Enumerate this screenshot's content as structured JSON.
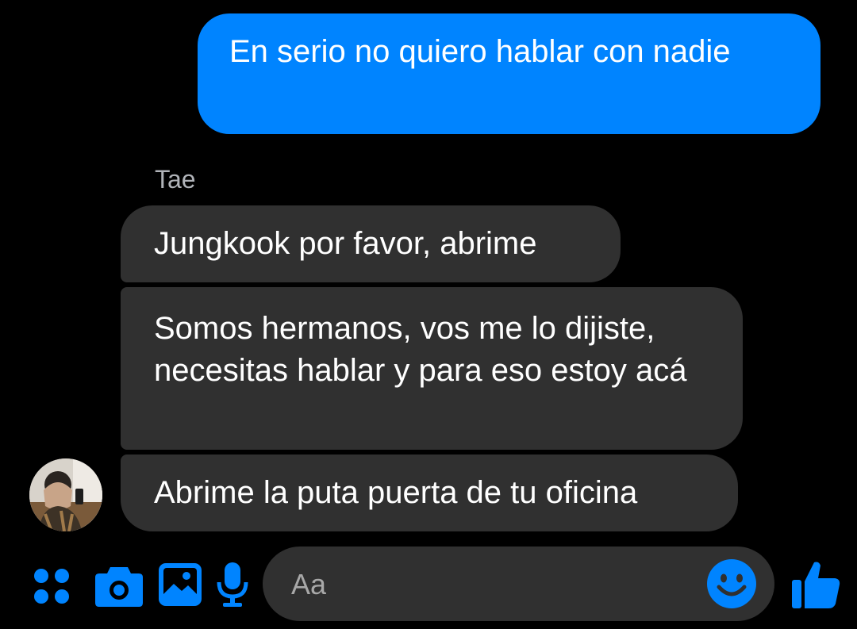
{
  "colors": {
    "accent": "#0084ff",
    "received_bubble": "#303030",
    "background": "#000000"
  },
  "messages": {
    "sent": [
      {
        "text": "En serio no quiero hablar con nadie"
      }
    ],
    "sender_name": "Tae",
    "received": [
      {
        "text": "Jungkook por favor, abrime"
      },
      {
        "text": "Somos hermanos, vos me lo dijiste, necesitas hablar y para eso estoy acá"
      },
      {
        "text": "Abrime la puta puerta de tu oficina"
      }
    ]
  },
  "avatar": {
    "alt": "Tae"
  },
  "toolbar": {
    "icons": [
      "apps-icon",
      "camera-icon",
      "gallery-icon",
      "microphone-icon"
    ],
    "composer_placeholder": "Aa",
    "emoji_icon": "smiley-icon",
    "like_icon": "thumbs-up-icon"
  }
}
